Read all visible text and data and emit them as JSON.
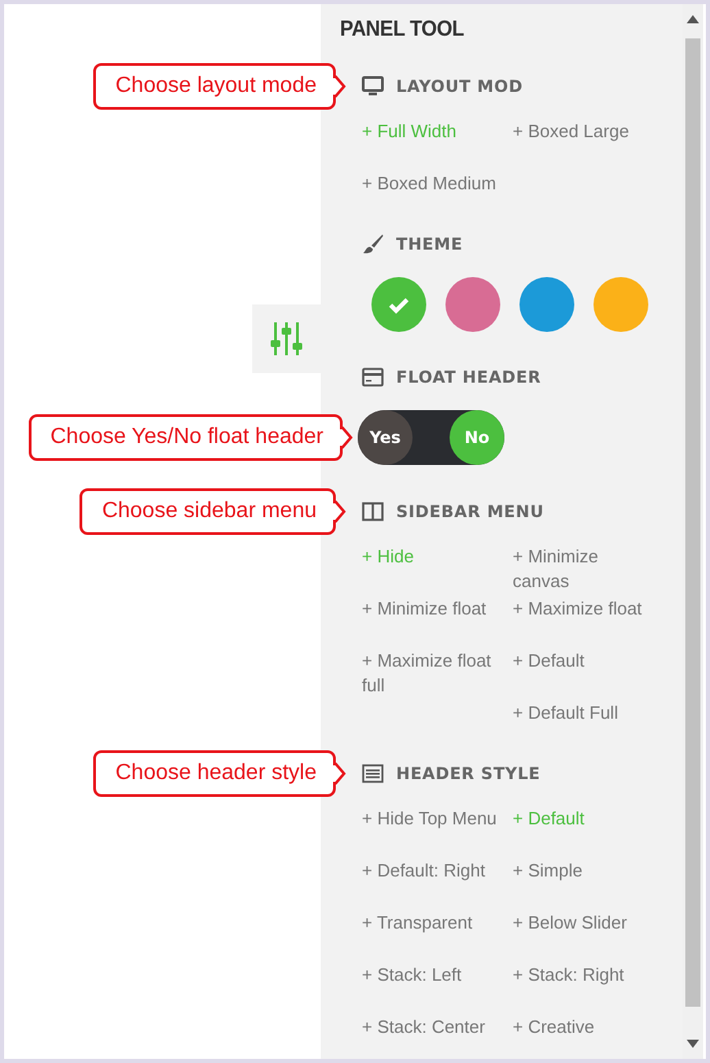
{
  "panel": {
    "title": "PANEL TOOL"
  },
  "sections": [
    {
      "kind": "options",
      "title": "LAYOUT MOD",
      "callout": "Choose layout mode",
      "columns": [
        [
          {
            "label": "+ Full Width",
            "selected": true
          },
          {
            "label": "+ Boxed Medium",
            "selected": false
          }
        ],
        [
          {
            "label": "+ Boxed Large",
            "selected": false
          }
        ]
      ]
    },
    {
      "kind": "colors",
      "title": "THEME",
      "colors": [
        {
          "color": "#4cbf3f",
          "selected": true
        },
        {
          "color": "#d86c94",
          "selected": false
        },
        {
          "color": "#1c9ad8",
          "selected": false
        },
        {
          "color": "#fbb118",
          "selected": false
        }
      ]
    },
    {
      "kind": "toggle",
      "title": "FLOAT HEADER",
      "toggle": {
        "callout": "Choose Yes/No float header",
        "options": [
          {
            "label": "Yes",
            "selected": false
          },
          {
            "label": "No",
            "selected": true
          }
        ]
      }
    },
    {
      "kind": "options",
      "title": "SIDEBAR MENU",
      "callout": "Choose sidebar menu",
      "columns": [
        [
          {
            "label": "+ Hide",
            "selected": true
          },
          {
            "label": "+ Minimize float",
            "selected": false
          },
          {
            "label": "+ Maximize float full",
            "selected": false
          }
        ],
        [
          {
            "label": "+ Minimize canvas",
            "selected": false
          },
          {
            "label": "+ Maximize float",
            "selected": false
          },
          {
            "label": "+ Default",
            "selected": false
          },
          {
            "label": "+ Default Full",
            "selected": false
          }
        ]
      ]
    },
    {
      "kind": "options",
      "title": "HEADER STYLE",
      "callout": "Choose header style",
      "columns": [
        [
          {
            "label": "+ Hide Top Menu",
            "selected": false
          },
          {
            "label": "+ Default: Right",
            "selected": false
          },
          {
            "label": "+ Transparent",
            "selected": false
          },
          {
            "label": "+ Stack: Left",
            "selected": false
          },
          {
            "label": "+ Stack: Center",
            "selected": false
          }
        ],
        [
          {
            "label": "+ Default",
            "selected": true
          },
          {
            "label": "+ Simple",
            "selected": false
          },
          {
            "label": "+ Below Slider",
            "selected": false
          },
          {
            "label": "+ Stack: Right",
            "selected": false
          },
          {
            "label": "+ Creative",
            "selected": false
          }
        ]
      ]
    }
  ]
}
